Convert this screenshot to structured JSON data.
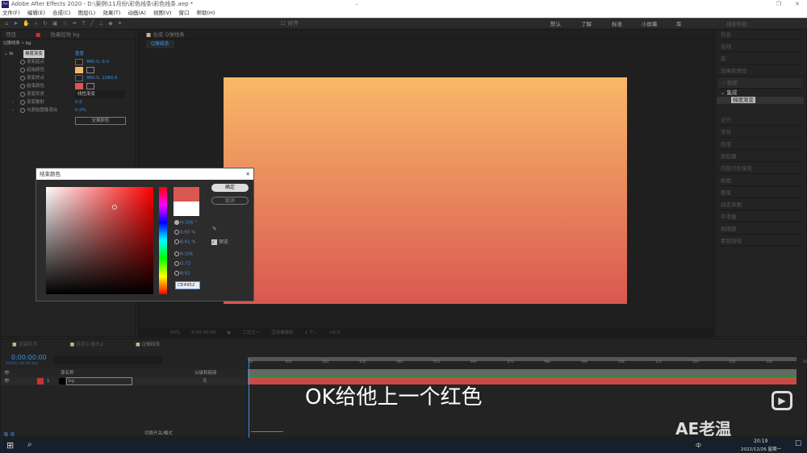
{
  "app": {
    "title": "Adobe After Effects 2020 - D:\\案例\\11月份\\彩色线条\\彩色线条.aep *",
    "logo": "Ae"
  },
  "menu": [
    "文件(F)",
    "编辑(E)",
    "合成(C)",
    "图层(L)",
    "效果(T)",
    "动画(A)",
    "视图(V)",
    "窗口",
    "帮助(H)"
  ],
  "toolbar": {
    "align_label": "对齐",
    "workspaces": [
      "默认",
      "了解",
      "标准",
      "小屏幕",
      "库"
    ],
    "search_placeholder": "搜索帮助"
  },
  "left_panel": {
    "tabs": [
      "项目",
      "效果控件 bg"
    ],
    "breadcrumb": "Q弹线条 • bg",
    "effect_name": "梯度渐变",
    "reset": "重置",
    "props": [
      {
        "name": "渐变起点",
        "value": "960.0, 0.0"
      },
      {
        "name": "起始颜色",
        "value": "",
        "color": "#f9b868"
      },
      {
        "name": "渐变终点",
        "value": "960.0, 1080.0"
      },
      {
        "name": "结束颜色",
        "value": "",
        "color": "#ce4952"
      },
      {
        "name": "渐变形状",
        "value": "线性渐变"
      },
      {
        "name": "渐变散射",
        "value": "0.0"
      },
      {
        "name": "与原始图像混合",
        "value": "0.0%"
      }
    ],
    "swap_button": "交换颜色"
  },
  "comp": {
    "tab": "合成 Q弹线条",
    "subtab": "Q弹线条",
    "zoom": "50%",
    "timecode": "0:00:00:00",
    "resolution": "二分之一",
    "camera": "活动摄像机",
    "views": "1 个...",
    "exposure": "+0.0"
  },
  "dialog": {
    "title": "结束颜色",
    "ok": "确定",
    "cancel": "取消",
    "preview": "预览",
    "preview_checked": true,
    "fields": [
      {
        "label": "H:",
        "value": "356",
        "unit": "°"
      },
      {
        "label": "S:",
        "value": "65",
        "unit": "%"
      },
      {
        "label": "B:",
        "value": "81",
        "unit": "%"
      },
      {
        "label": "R:",
        "value": "206",
        "unit": ""
      },
      {
        "label": "G:",
        "value": "73",
        "unit": ""
      },
      {
        "label": "B:",
        "value": "82",
        "unit": ""
      }
    ],
    "hex": "CE4952",
    "new_color": "#ce4952",
    "old_color": "#ffffff"
  },
  "right_panel": [
    "信息",
    "音频",
    "库",
    "效果和预设",
    "梯度",
    "集成",
    "梯度渐变",
    "对齐",
    "字符",
    "段落",
    "跟踪器",
    "内容识别填充",
    "绘画",
    "画笔",
    "动态草图",
    "平滑器",
    "摇摆器",
    "蒙版插值"
  ],
  "timeline": {
    "tabs": [
      "渲染队列",
      "线条2-镜头2",
      "Q弹线条"
    ],
    "timecode": "0:00:00:00",
    "fps": "00000 (30.00 fps)",
    "col_source": "源名称",
    "col_parent": "父级和链接",
    "layer": {
      "num": "1",
      "name": "bg",
      "parent": "无"
    },
    "ticks": [
      "0s",
      "01s",
      "02s",
      "03s",
      "04s",
      "05s",
      "06s",
      "07s",
      "08s",
      "09s",
      "10s",
      "11s",
      "12s",
      "13s",
      "14s",
      "15s"
    ],
    "mode_toggle": "切换开关/模式"
  },
  "subtitle": "OK给他上一个红色",
  "watermark": "AE老温",
  "taskbar": {
    "time": "20:19",
    "date": "2022/12/26 星期一",
    "ime": "中"
  }
}
